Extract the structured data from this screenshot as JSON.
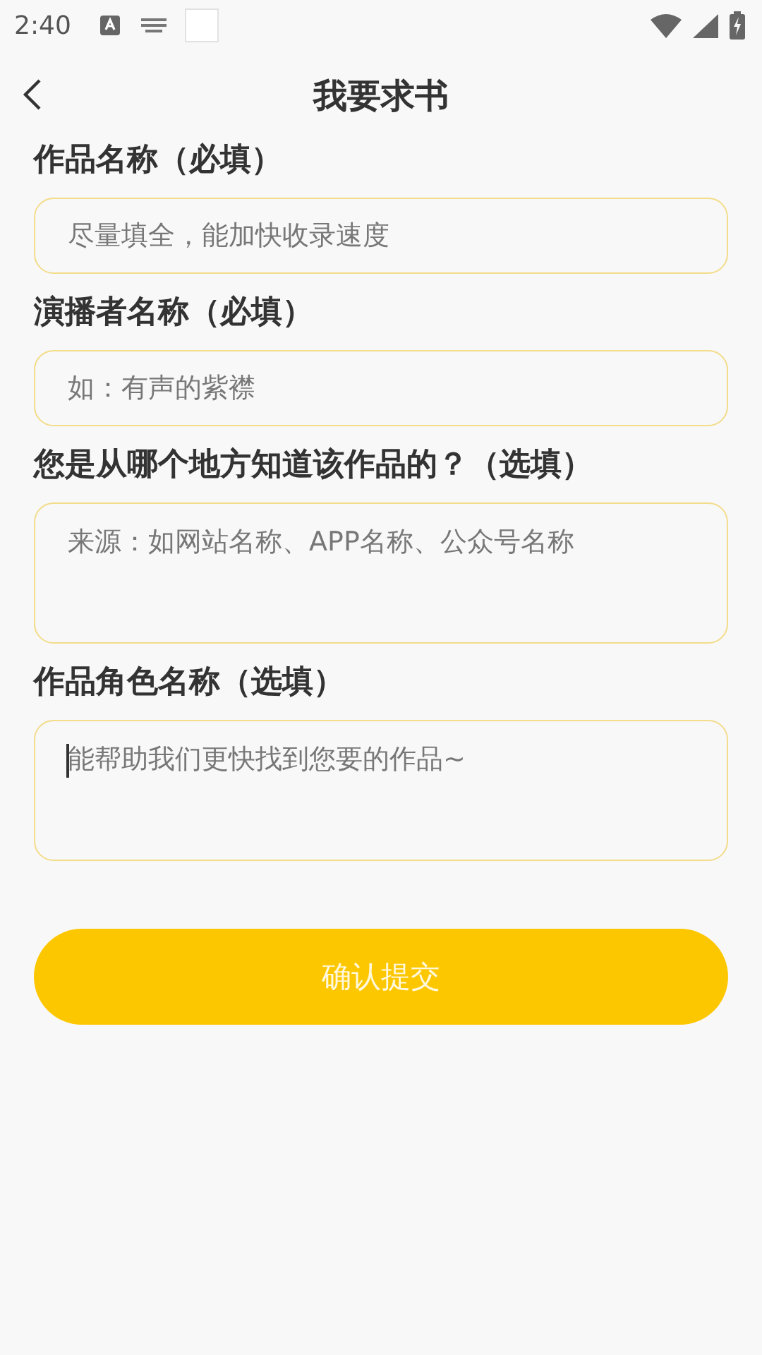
{
  "status_bar": {
    "time": "2:40"
  },
  "header": {
    "title": "我要求书"
  },
  "fields": [
    {
      "label": "作品名称（必填）",
      "placeholder": "尽量填全，能加快收录速度",
      "kind": "single",
      "focused": false
    },
    {
      "label": "演播者名称（必填）",
      "placeholder": "如：有声的紫襟",
      "kind": "single",
      "focused": false
    },
    {
      "label": "您是从哪个地方知道该作品的？（选填）",
      "placeholder": "来源：如网站名称、APP名称、公众号名称",
      "kind": "multi",
      "focused": false
    },
    {
      "label": "作品角色名称（选填）",
      "placeholder": "能帮助我们更快找到您要的作品~",
      "kind": "multi",
      "focused": true
    }
  ],
  "submit_button": "确认提交"
}
